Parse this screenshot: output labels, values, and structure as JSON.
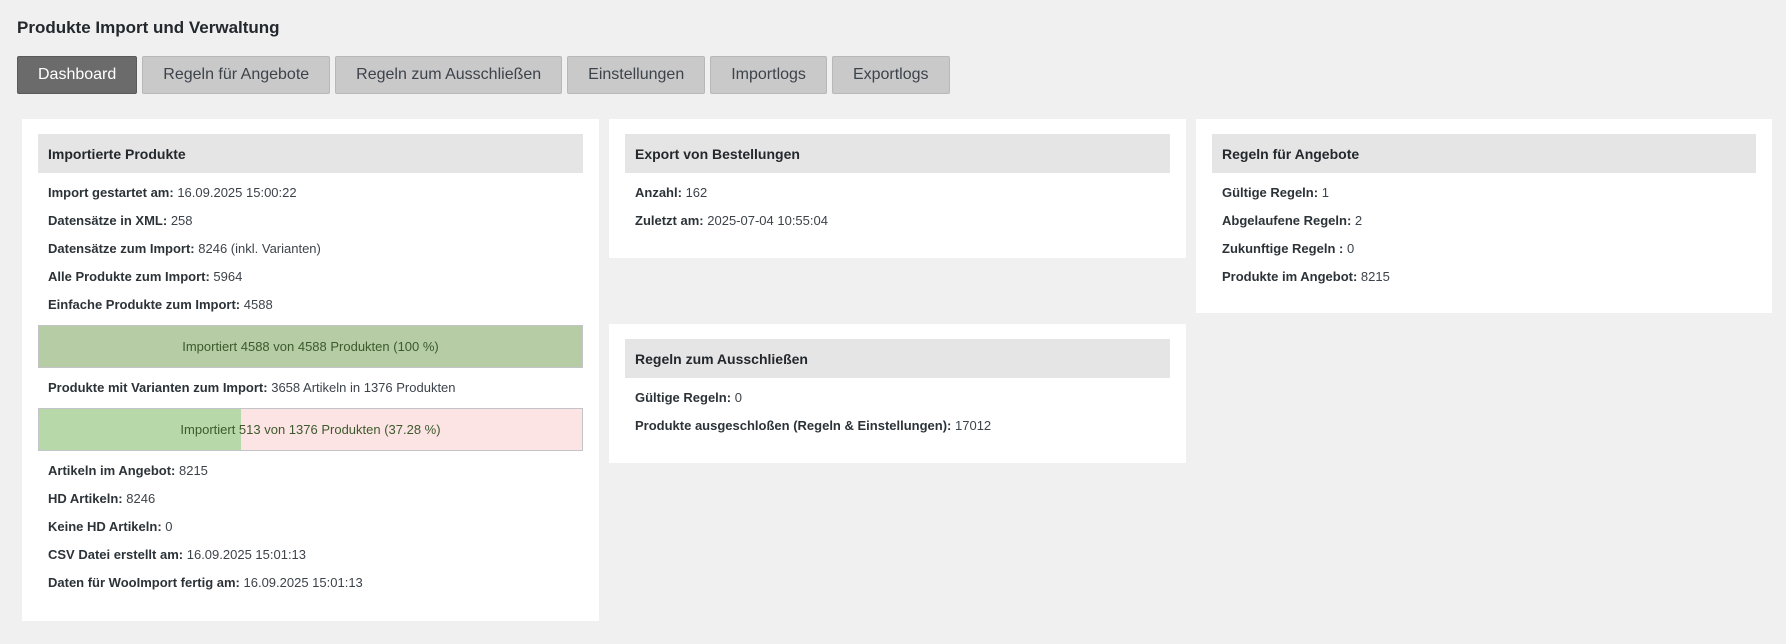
{
  "page_title": "Produkte Import und Verwaltung",
  "tabs": [
    {
      "label": "Dashboard",
      "active": true
    },
    {
      "label": "Regeln für Angebote",
      "active": false
    },
    {
      "label": "Regeln zum Ausschließen",
      "active": false
    },
    {
      "label": "Einstellungen",
      "active": false
    },
    {
      "label": "Importlogs",
      "active": false
    },
    {
      "label": "Exportlogs",
      "active": false
    }
  ],
  "imported": {
    "title": "Importierte Produkte",
    "rows_top": [
      {
        "k": "Import gestartet am:",
        "v": "16.09.2025 15:00:22"
      },
      {
        "k": "Datensätze in XML:",
        "v": "258"
      },
      {
        "k": "Datensätze zum Import:",
        "v": "8246 (inkl. Varianten)"
      },
      {
        "k": "Alle Produkte zum Import:",
        "v": "5964"
      },
      {
        "k": "Einfache Produkte zum Import:",
        "v": "4588"
      }
    ],
    "progress1": {
      "label": "Importiert 4588 von 4588 Produkten (100 %)",
      "fraction": 1.0,
      "fill_color": "#b5cca5",
      "bg_color": "#fde4e4"
    },
    "variants_row": {
      "k": "Produkte mit Varianten zum Import:",
      "v": "3658 Artikeln in 1376 Produkten"
    },
    "progress2": {
      "label": "Importiert 513 von 1376 Produkten (37.28 %)",
      "fraction": 0.3728,
      "fill_color": "#b7d8a8",
      "bg_color": "#fde4e4"
    },
    "rows_bottom": [
      {
        "k": "Artikeln im Angebot:",
        "v": "8215"
      },
      {
        "k": "HD Artikeln:",
        "v": "8246"
      },
      {
        "k": "Keine HD Artikeln:",
        "v": "0"
      },
      {
        "k": "CSV Datei erstellt am:",
        "v": "16.09.2025 15:01:13"
      },
      {
        "k": "Daten für WooImport fertig am:",
        "v": "16.09.2025 15:01:13"
      }
    ]
  },
  "export": {
    "title": "Export von Bestellungen",
    "rows": [
      {
        "k": "Anzahl:",
        "v": "162"
      },
      {
        "k": "Zuletzt am:",
        "v": "2025-07-04 10:55:04"
      }
    ]
  },
  "exclude": {
    "title": "Regeln zum Ausschließen",
    "rows": [
      {
        "k": "Gültige Regeln:",
        "v": "0"
      },
      {
        "k": "Produkte ausgeschloßen (Regeln & Einstellungen):",
        "v": "17012"
      }
    ]
  },
  "offers": {
    "title": "Regeln für Angebote",
    "rows": [
      {
        "k": "Gültige Regeln:",
        "v": "1"
      },
      {
        "k": "Abgelaufene Regeln:",
        "v": "2"
      },
      {
        "k": "Zukunftige Regeln :",
        "v": "0"
      },
      {
        "k": "Produkte im Angebot:",
        "v": "8215"
      }
    ]
  }
}
